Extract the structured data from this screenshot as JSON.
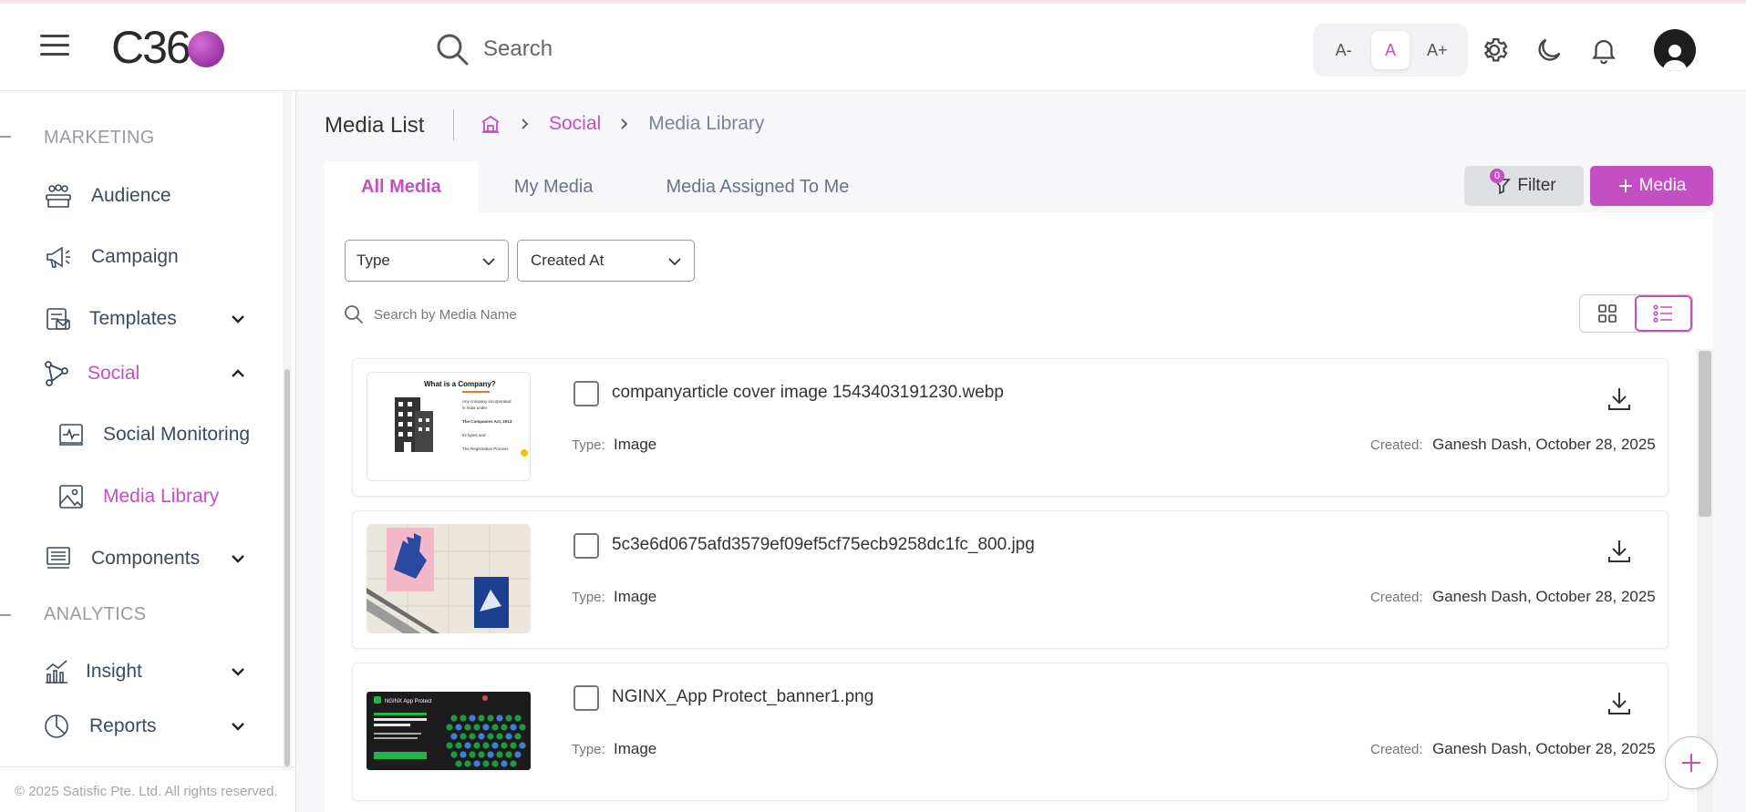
{
  "header": {
    "logo_text": "C36",
    "search_placeholder": "Search",
    "font_sizes": [
      "A-",
      "A",
      "A+"
    ]
  },
  "sidebar": {
    "sections": [
      "MARKETING",
      "ANALYTICS"
    ],
    "items": [
      {
        "label": "Audience"
      },
      {
        "label": "Campaign"
      },
      {
        "label": "Templates"
      },
      {
        "label": "Social"
      },
      {
        "label": "Social Monitoring"
      },
      {
        "label": "Media Library"
      },
      {
        "label": "Components"
      },
      {
        "label": "Insight"
      },
      {
        "label": "Reports"
      }
    ],
    "footer": "© 2025 Satisfic Pte. Ltd. All rights reserved."
  },
  "page": {
    "title": "Media List",
    "breadcrumb": [
      "Social",
      "Media Library"
    ]
  },
  "tabs": [
    "All Media",
    "My Media",
    "Media Assigned To Me"
  ],
  "buttons": {
    "filter": "Filter",
    "filter_count": "0",
    "add_media": "Media"
  },
  "filters": {
    "type": "Type",
    "created_at": "Created At",
    "search_placeholder": "Search by Media Name"
  },
  "media": [
    {
      "name": "companyarticle cover image 1543403191230.webp",
      "type_label": "Type:",
      "type": "Image",
      "created_label": "Created:",
      "created": "Ganesh Dash, October 28, 2025"
    },
    {
      "name": "5c3e6d0675afd3579ef09ef5cf75ecb9258dc1fc_800.jpg",
      "type_label": "Type:",
      "type": "Image",
      "created_label": "Created:",
      "created": "Ganesh Dash, October 28, 2025"
    },
    {
      "name": "NGINX_App Protect_banner1.png",
      "type_label": "Type:",
      "type": "Image",
      "created_label": "Created:",
      "created": "Ganesh Dash, October 28, 2025"
    }
  ],
  "thumbs": {
    "t1_title": "What is a Company?",
    "t1_lines": [
      "Any company incorporated",
      "in India under",
      "The Companies Act, 2013",
      "Its types and",
      "The Registration Process"
    ],
    "t3_title": "NGINX App Protect"
  },
  "colors": {
    "accent": "#c34fc4",
    "text": "#333333",
    "muted": "#7a8499"
  }
}
